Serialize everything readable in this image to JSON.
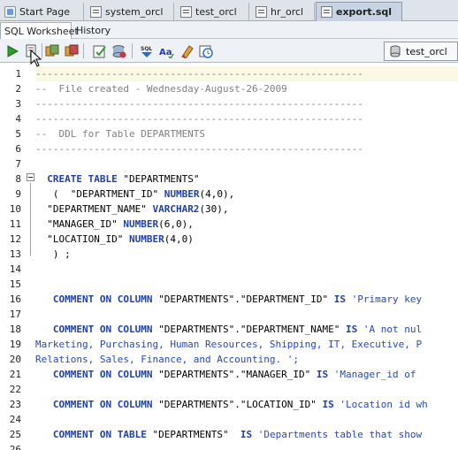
{
  "document_tabs": [
    {
      "label": "Start Page",
      "icon": "start-page-icon",
      "active": false
    },
    {
      "label": "system_orcl",
      "icon": "database-connection-icon",
      "active": false
    },
    {
      "label": "test_orcl",
      "icon": "database-connection-icon",
      "active": false
    },
    {
      "label": "hr_orcl",
      "icon": "database-connection-icon",
      "active": false
    },
    {
      "label": "export.sql",
      "icon": "sql-file-icon",
      "active": true
    }
  ],
  "sub_tabs": [
    {
      "label": "SQL Worksheet",
      "active": true
    },
    {
      "label": "History",
      "active": false
    }
  ],
  "toolbar": {
    "buttons": [
      "run-statement-icon",
      "run-script-icon",
      "commit-icon",
      "rollback-icon",
      "explain-plan-icon",
      "autotrace-icon",
      "sql-tuning-icon",
      "format-case-icon",
      "clear-icon",
      "history-icon"
    ],
    "connection": "test_orcl"
  },
  "editor": {
    "lines": [
      {
        "n": "1",
        "text": "--------------------------------------------------------",
        "kind": "comment"
      },
      {
        "n": "2",
        "text": "--  File created - Wednesday-August-26-2009",
        "kind": "comment"
      },
      {
        "n": "3",
        "text": "--------------------------------------------------------",
        "kind": "comment"
      },
      {
        "n": "4",
        "text": "--------------------------------------------------------",
        "kind": "comment"
      },
      {
        "n": "5",
        "text": "--  DDL for Table DEPARTMENTS",
        "kind": "comment"
      },
      {
        "n": "6",
        "text": "--------------------------------------------------------",
        "kind": "comment"
      },
      {
        "n": "7",
        "text": "",
        "kind": "code"
      },
      {
        "n": "8",
        "text": "  CREATE TABLE \"DEPARTMENTS\"",
        "kind": "code"
      },
      {
        "n": "9",
        "text": "   (  \"DEPARTMENT_ID\" NUMBER(4,0),",
        "kind": "code"
      },
      {
        "n": "10",
        "text": "  \"DEPARTMENT_NAME\" VARCHAR2(30),",
        "kind": "code"
      },
      {
        "n": "11",
        "text": "  \"MANAGER_ID\" NUMBER(6,0),",
        "kind": "code"
      },
      {
        "n": "12",
        "text": "  \"LOCATION_ID\" NUMBER(4,0)",
        "kind": "code"
      },
      {
        "n": "13",
        "text": "   ) ;",
        "kind": "code"
      },
      {
        "n": "14",
        "text": "",
        "kind": "code"
      },
      {
        "n": "15",
        "text": "",
        "kind": "code"
      },
      {
        "n": "16",
        "text": "   COMMENT ON COLUMN \"DEPARTMENTS\".\"DEPARTMENT_ID\" IS 'Primary key",
        "kind": "code"
      },
      {
        "n": "17",
        "text": "",
        "kind": "code"
      },
      {
        "n": "18",
        "text": "   COMMENT ON COLUMN \"DEPARTMENTS\".\"DEPARTMENT_NAME\" IS 'A not nul",
        "kind": "code"
      },
      {
        "n": "",
        "text": "Marketing, Purchasing, Human Resources, Shipping, IT, Executive, P",
        "kind": "string"
      },
      {
        "n": "",
        "text": "Relations, Sales, Finance, and Accounting. ';",
        "kind": "string"
      },
      {
        "n": "22",
        "text": "   COMMENT ON COLUMN \"DEPARTMENTS\".\"MANAGER_ID\" IS 'Manager_id of",
        "kind": "code"
      },
      {
        "n": "23",
        "text": "",
        "kind": "code"
      },
      {
        "n": "24",
        "text": "   COMMENT ON COLUMN \"DEPARTMENTS\".\"LOCATION_ID\" IS 'Location id wh",
        "kind": "code"
      },
      {
        "n": "25",
        "text": "",
        "kind": "code"
      },
      {
        "n": "26",
        "text": "   COMMENT ON TABLE \"DEPARTMENTS\"  IS 'Departments table that show",
        "kind": "code"
      }
    ],
    "gutter_numbers": [
      "1",
      "2",
      "3",
      "4",
      "5",
      "6",
      "7",
      "8",
      "9",
      "10",
      "11",
      "12",
      "13",
      "14",
      "15",
      "16",
      "17",
      "18",
      "19",
      "20",
      "21",
      "22",
      "23",
      "24",
      "25",
      "26"
    ]
  },
  "colors": {
    "keyword": "#1f3fa8",
    "string": "#2647b8",
    "comment": "#7f7f7f",
    "current_line": "#fbf9e3"
  }
}
